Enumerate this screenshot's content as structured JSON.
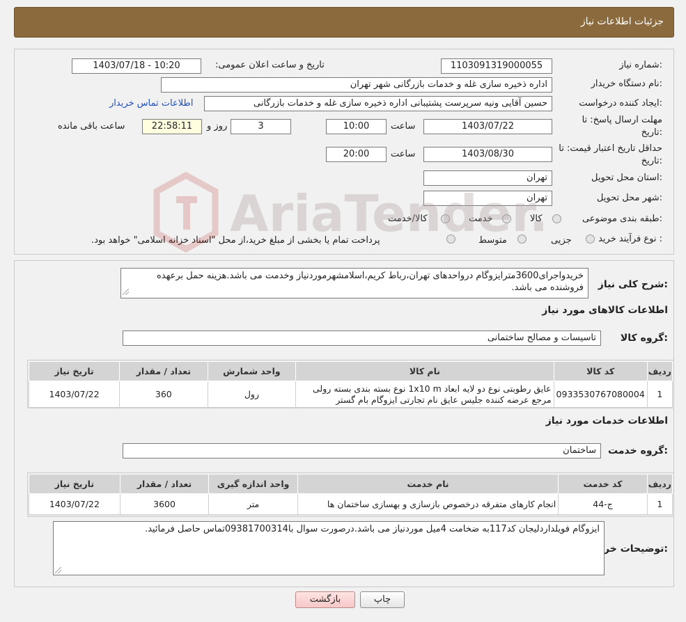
{
  "header": {
    "title": "جزئیات اطلاعات نیاز"
  },
  "info": {
    "need_number_label": "شماره نیاز:",
    "need_number": "1103091319000055",
    "announce_label": "تاریخ و ساعت اعلان عمومی:",
    "announce_value": "1403/07/18 - 10:20",
    "buyer_org_label": "نام دستگاه خریدار:",
    "buyer_org": "اداره ذخیره سازی غله و خدمات بازرگانی شهر تهران",
    "creator_label": "ایجاد کننده درخواست:",
    "creator": "حسین آقایی ونیه سرپرست پشتیبانی اداره ذخیره سازی غله و خدمات بازرگانی",
    "contact_link": "اطلاعات تماس خریدار",
    "deadline_label_1": "مهلت ارسال پاسخ: تا",
    "deadline_label_2": "تاریخ:",
    "deadline_date": "1403/07/22",
    "time_label": "ساعت",
    "deadline_time": "10:00",
    "days_value": "3",
    "days_label": "روز و",
    "remaining_time": "22:58:11",
    "remaining_label": "ساعت باقی مانده",
    "validity_label_1": "حداقل تاریخ اعتبار قیمت: تا",
    "validity_label_2": "تاریخ:",
    "validity_date": "1403/08/30",
    "validity_time": "20:00",
    "province_label": "استان محل تحویل:",
    "province": "تهران",
    "city_label": "شهر محل تحویل:",
    "city": "تهران",
    "category_label": "طبقه بندی موضوعی:",
    "category_options": [
      "کالا",
      "خدمت",
      "کالا/خدمت"
    ],
    "process_label": "نوع فرآیند خرید :",
    "process_options": [
      "جزیی",
      "متوسط"
    ],
    "process_note": "پرداخت تمام یا بخشی از مبلغ خرید،از محل \"اسناد خزانه اسلامی\" خواهد بود."
  },
  "description": {
    "label": "شرح کلی نیاز:",
    "text": "خریدواجرای3600مترایزوگام درواحدهای تهران،رباط کریم،اسلامشهرموردنیاز وخدمت می باشد.هزینه حمل برعهده فروشنده می باشد."
  },
  "goods": {
    "section_title": "اطلاعات کالاهای مورد نیاز",
    "group_label": "گروه کالا:",
    "group_value": "تاسیسات و مصالح ساختمانی",
    "headers": [
      "ردیف",
      "کد کالا",
      "نام کالا",
      "واحد شمارش",
      "تعداد / مقدار",
      "تاریخ نیاز"
    ],
    "rows": [
      {
        "row": "1",
        "code": "0933530767080004",
        "name": "عایق رطوبتی نوع دو لایه ابعاد 1x10 m نوع بسته بندی بسته رولی مرجع عرضه کننده جلیس عایق نام تجارتی ایزوگام بام گستر",
        "unit": "رول",
        "qty": "360",
        "date": "1403/07/22"
      }
    ]
  },
  "services": {
    "section_title": "اطلاعات خدمات مورد نیاز",
    "group_label": "گروه خدمت:",
    "group_value": "ساختمان",
    "headers": [
      "ردیف",
      "کد خدمت",
      "نام خدمت",
      "واحد اندازه گیری",
      "تعداد / مقدار",
      "تاریخ نیاز"
    ],
    "rows": [
      {
        "row": "1",
        "code": "ج-44",
        "name": "انجام کارهای متفرقه درخصوص بازسازی و بهسازی ساختمان ها",
        "unit": "متر",
        "qty": "3600",
        "date": "1403/07/22"
      }
    ]
  },
  "buyer_notes": {
    "label": "توضیحات خریدار:",
    "text": "ایزوگام فویلداردلیجان کد117به ضخامت 4میل موردنیاز می باشد.درصورت سوال با09381700314تماس حاصل فرمائید."
  },
  "buttons": {
    "print": "چاپ",
    "back": "بازگشت"
  },
  "watermark": {
    "text": "AriaTender.neT"
  },
  "colors": {
    "header": "#8b6b3d",
    "link": "#1f4fbf",
    "remaining_bg": "#ffffe0"
  }
}
